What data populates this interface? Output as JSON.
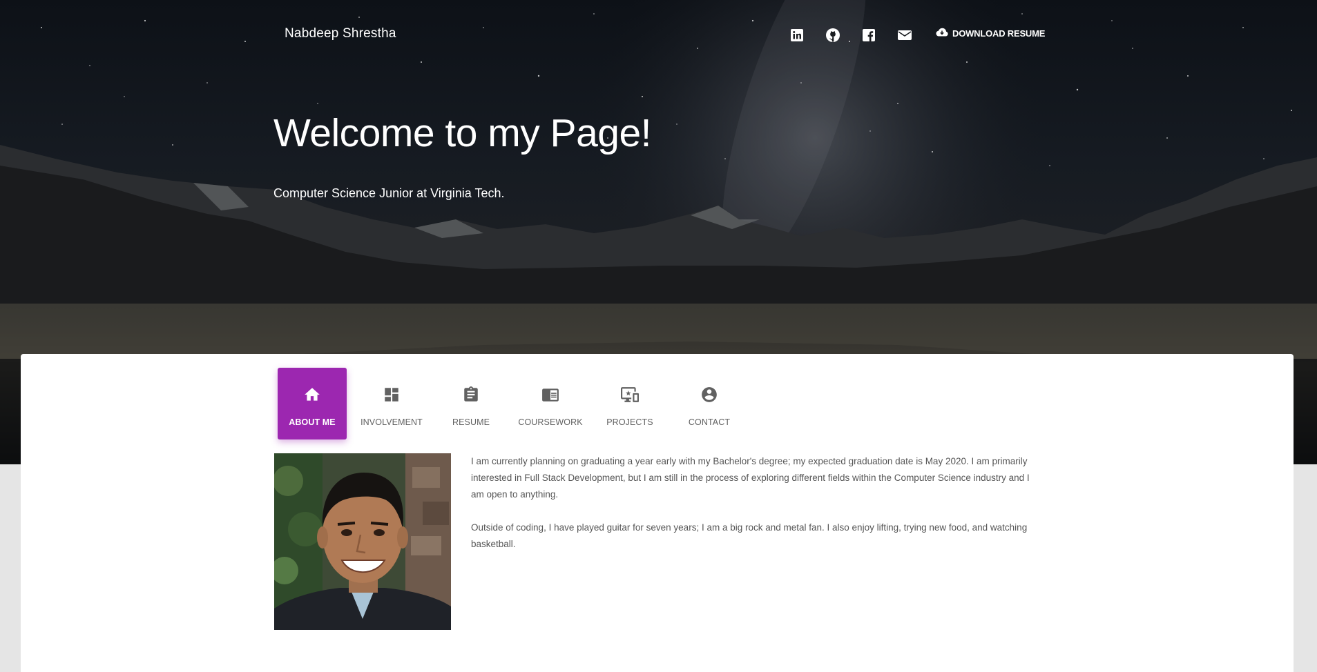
{
  "nav": {
    "brand": "Nabdeep Shrestha",
    "icons": [
      "linkedin-icon",
      "github-icon",
      "facebook-icon",
      "envelope-icon"
    ],
    "download_label": "DOWNLOAD RESUME",
    "download_icon": "cloud-download-icon"
  },
  "hero": {
    "title": "Welcome to my Page!",
    "subtitle": "Computer Science Junior at Virginia Tech."
  },
  "tabs": [
    {
      "label": "ABOUT ME",
      "icon": "home-icon",
      "active": true
    },
    {
      "label": "INVOLVEMENT",
      "icon": "dashboard-icon",
      "active": false
    },
    {
      "label": "RESUME",
      "icon": "clipboard-icon",
      "active": false
    },
    {
      "label": "COURSEWORK",
      "icon": "chrome-reader-icon",
      "active": false
    },
    {
      "label": "PROJECTS",
      "icon": "devices-icon",
      "active": false
    },
    {
      "label": "CONTACT",
      "icon": "account-circle-icon",
      "active": false
    }
  ],
  "about": {
    "paragraph1": "I am currently planning on graduating a year early with my Bachelor's degree; my expected graduation date is May 2020. I am primarily interested in Full Stack Development, but I am still in the process of exploring different fields within the Computer Science industry and I am open to anything.",
    "paragraph2": "Outside of coding, I have played guitar for seven years; I am a big rock and metal fan. I also enjoy lifting, trying new food, and watching basketball."
  },
  "colors": {
    "accent": "#9c27b0",
    "tab_text": "#616161",
    "body_text": "#555555"
  }
}
